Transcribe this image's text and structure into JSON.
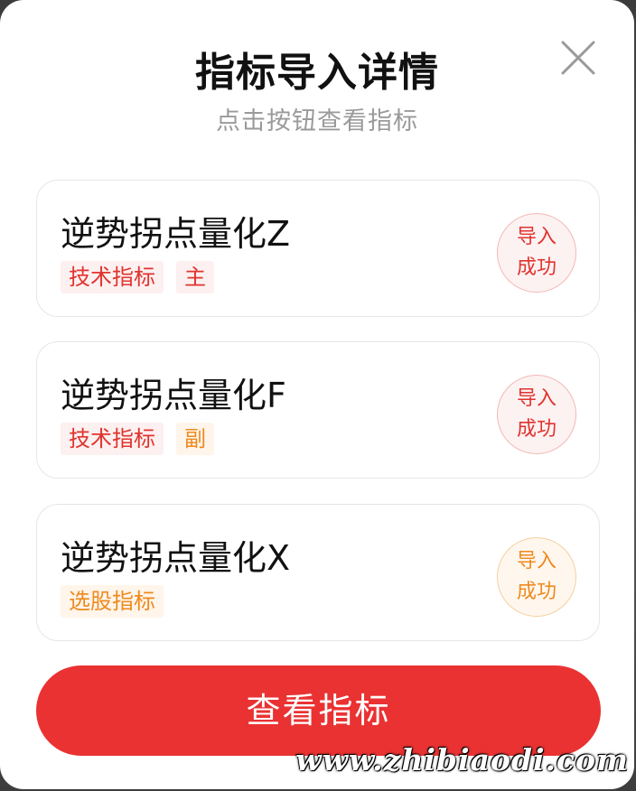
{
  "dialog": {
    "title": "指标导入详情",
    "subtitle": "点击按钮查看指标",
    "close_icon": "close-icon"
  },
  "indicators": [
    {
      "name": "逆势拐点量化Z",
      "tags": [
        {
          "label": "技术指标",
          "color": "#e0342f"
        },
        {
          "label": "主",
          "color": "#e0342f"
        }
      ],
      "status": [
        "导入",
        "成功"
      ],
      "status_color": "#e0342f"
    },
    {
      "name": "逆势拐点量化F",
      "tags": [
        {
          "label": "技术指标",
          "color": "#e0342f"
        },
        {
          "label": "副",
          "color": "#ee8a1f"
        }
      ],
      "status": [
        "导入",
        "成功"
      ],
      "status_color": "#e0342f"
    },
    {
      "name": "逆势拐点量化X",
      "tags": [
        {
          "label": "选股指标",
          "color": "#ee8a1f"
        }
      ],
      "status": [
        "导入",
        "成功"
      ],
      "status_color": "#ee8a1f"
    }
  ],
  "primary_button": {
    "label": "查看指标",
    "color": "#ea3232"
  },
  "watermark": "www.zhibiaodi.com"
}
